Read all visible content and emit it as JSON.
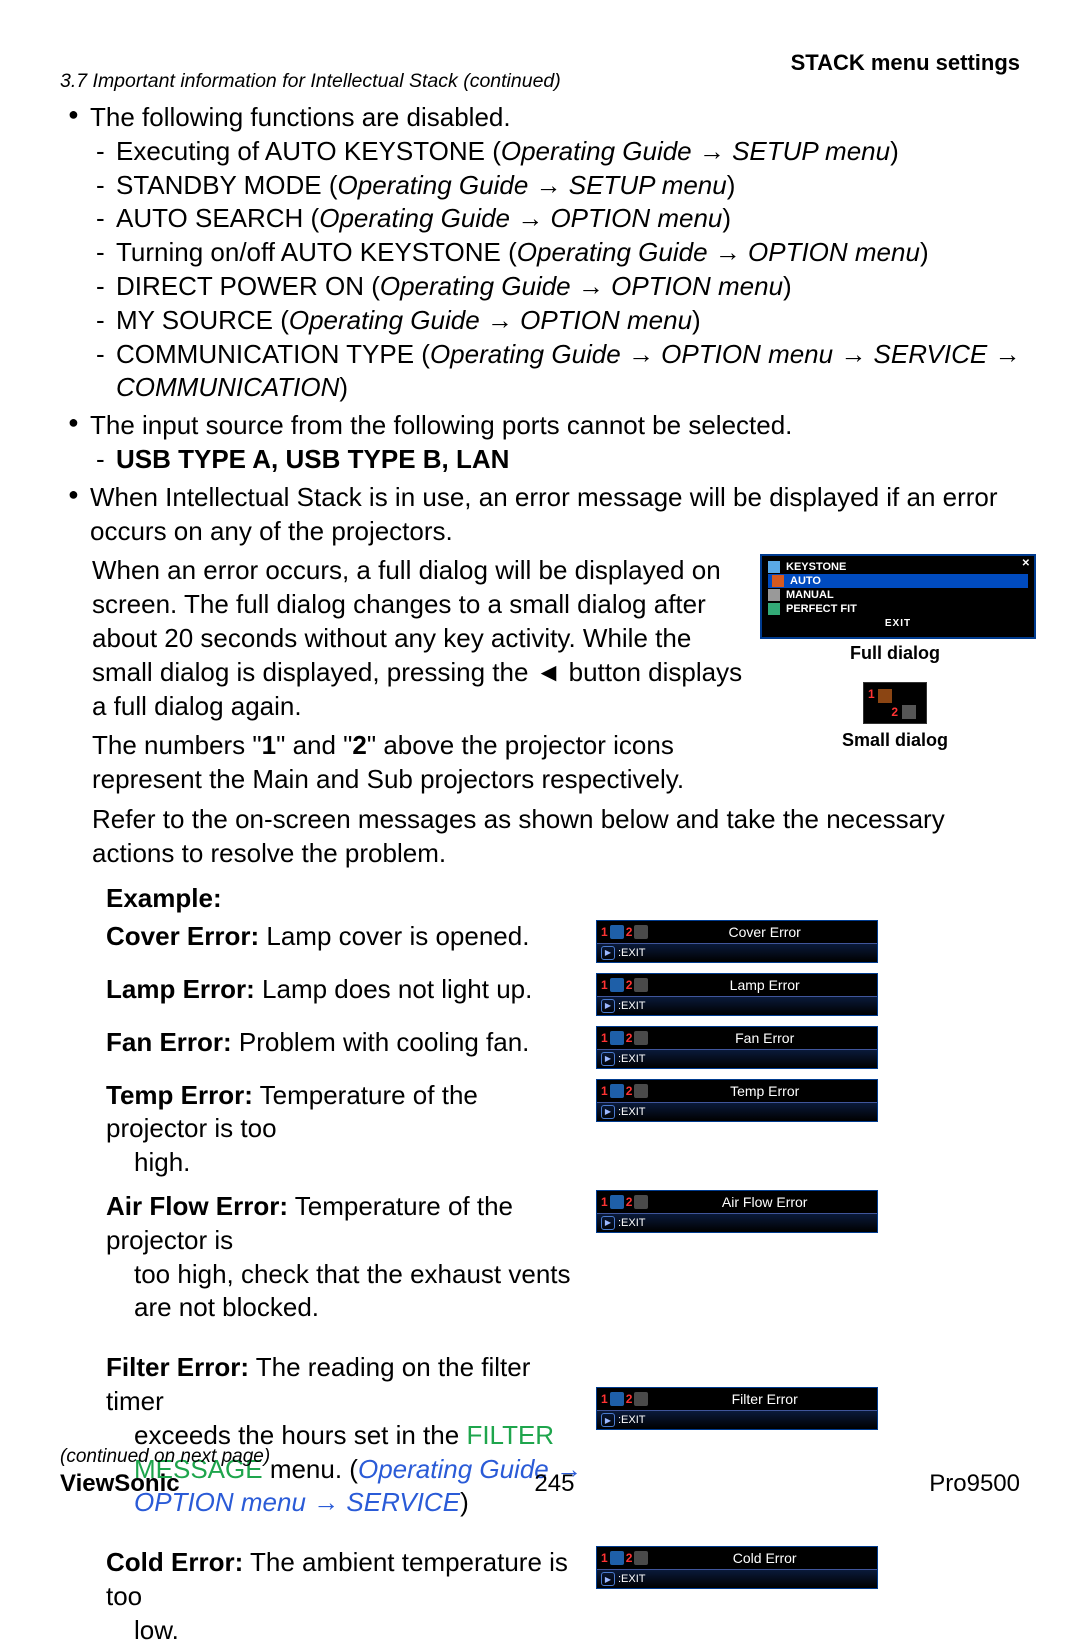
{
  "header": {
    "right": "STACK menu settings"
  },
  "section_title": "3.7 Important information for Intellectual Stack (continued)",
  "bullet1": {
    "intro": "The following functions are disabled.",
    "items": [
      {
        "pre": "Executing of AUTO KEYSTONE (",
        "it": "Operating Guide → SETUP menu",
        "post": ")"
      },
      {
        "pre": "STANDBY MODE (",
        "it": "Operating Guide → SETUP menu",
        "post": ")"
      },
      {
        "pre": "AUTO SEARCH (",
        "it": "Operating Guide → OPTION menu",
        "post": ")"
      },
      {
        "pre": "Turning on/off AUTO KEYSTONE (",
        "it": "Operating Guide → OPTION menu",
        "post": ")"
      },
      {
        "pre": "DIRECT POWER ON (",
        "it": "Operating Guide → OPTION menu",
        "post": ")"
      },
      {
        "pre": "MY SOURCE (",
        "it": "Operating Guide → OPTION menu",
        "post": ")"
      },
      {
        "pre": "COMMUNICATION TYPE (",
        "it": "Operating Guide → OPTION menu → SERVICE → COMMUNICATION",
        "post": ")"
      }
    ]
  },
  "bullet2": {
    "intro": "The input source from the following ports cannot be selected.",
    "bold_line": "USB TYPE A, USB TYPE B, LAN"
  },
  "bullet3": {
    "p1": "When Intellectual Stack is in use, an error message will be displayed if an error occurs on any of the projectors.",
    "p2": "When an error occurs, a full dialog will be displayed on screen.  The full dialog changes to a small dialog after about 20 seconds without any key activity. While the small dialog is displayed, pressing the ◄ button displays a full dialog again.",
    "p3a": "The numbers \"",
    "p3b": "\" and \"",
    "p3c": "\" above the projector icons represent the Main and Sub projectors respectively.",
    "num1": "1",
    "num2": "2",
    "p4": "Refer to the on-screen messages as shown below and take the necessary actions to resolve the problem."
  },
  "full_dialog": {
    "title": "KEYSTONE",
    "rows": [
      "AUTO",
      "MANUAL",
      "PERFECT FIT"
    ],
    "exit": "EXIT",
    "label": "Full dialog"
  },
  "small_dialog": {
    "label": "Small dialog"
  },
  "example": {
    "heading": "Example:",
    "errors": [
      {
        "lead": "Cover Error:",
        "desc": " Lamp cover is opened.",
        "msg": "Cover Error",
        "exit": ":EXIT"
      },
      {
        "lead": "Lamp Error:",
        "desc": " Lamp does not light up.",
        "msg": "Lamp Error",
        "exit": ":EXIT"
      },
      {
        "lead": "Fan Error:",
        "desc": " Problem with cooling fan.",
        "msg": "Fan Error",
        "exit": ":EXIT"
      },
      {
        "lead": "Temp Error:",
        "desc": " Temperature of the projector is too",
        "cont": "high.",
        "msg": "Temp Error",
        "exit": ":EXIT"
      },
      {
        "lead": "Air Flow Error:",
        "desc": " Temperature of the projector is",
        "cont": "too high, check that the exhaust vents are not blocked.",
        "msg": "Air Flow Error",
        "exit": ":EXIT",
        "bigGap": true
      },
      {
        "lead": "Filter Error:",
        "desc": " The reading on the filter timer",
        "cont_html": true,
        "cont_pre": "exceeds the hours set in the ",
        "green": "FILTER MESSAGE",
        "cont_mid": " menu.   (",
        "blue": "Operating Guide → OPTION menu → SERVICE",
        "cont_post": ")",
        "msg": "Filter Error",
        "exit": ":EXIT",
        "bigGap": true,
        "boxOffset": 36
      },
      {
        "lead": "Cold Error:",
        "desc": " The ambient temperature is too",
        "cont": "low.",
        "msg": "Cold Error",
        "exit": ":EXIT"
      }
    ]
  },
  "footer": {
    "continued": "(continued on next page)",
    "left": "ViewSonic",
    "center": "245",
    "right": "Pro9500"
  }
}
